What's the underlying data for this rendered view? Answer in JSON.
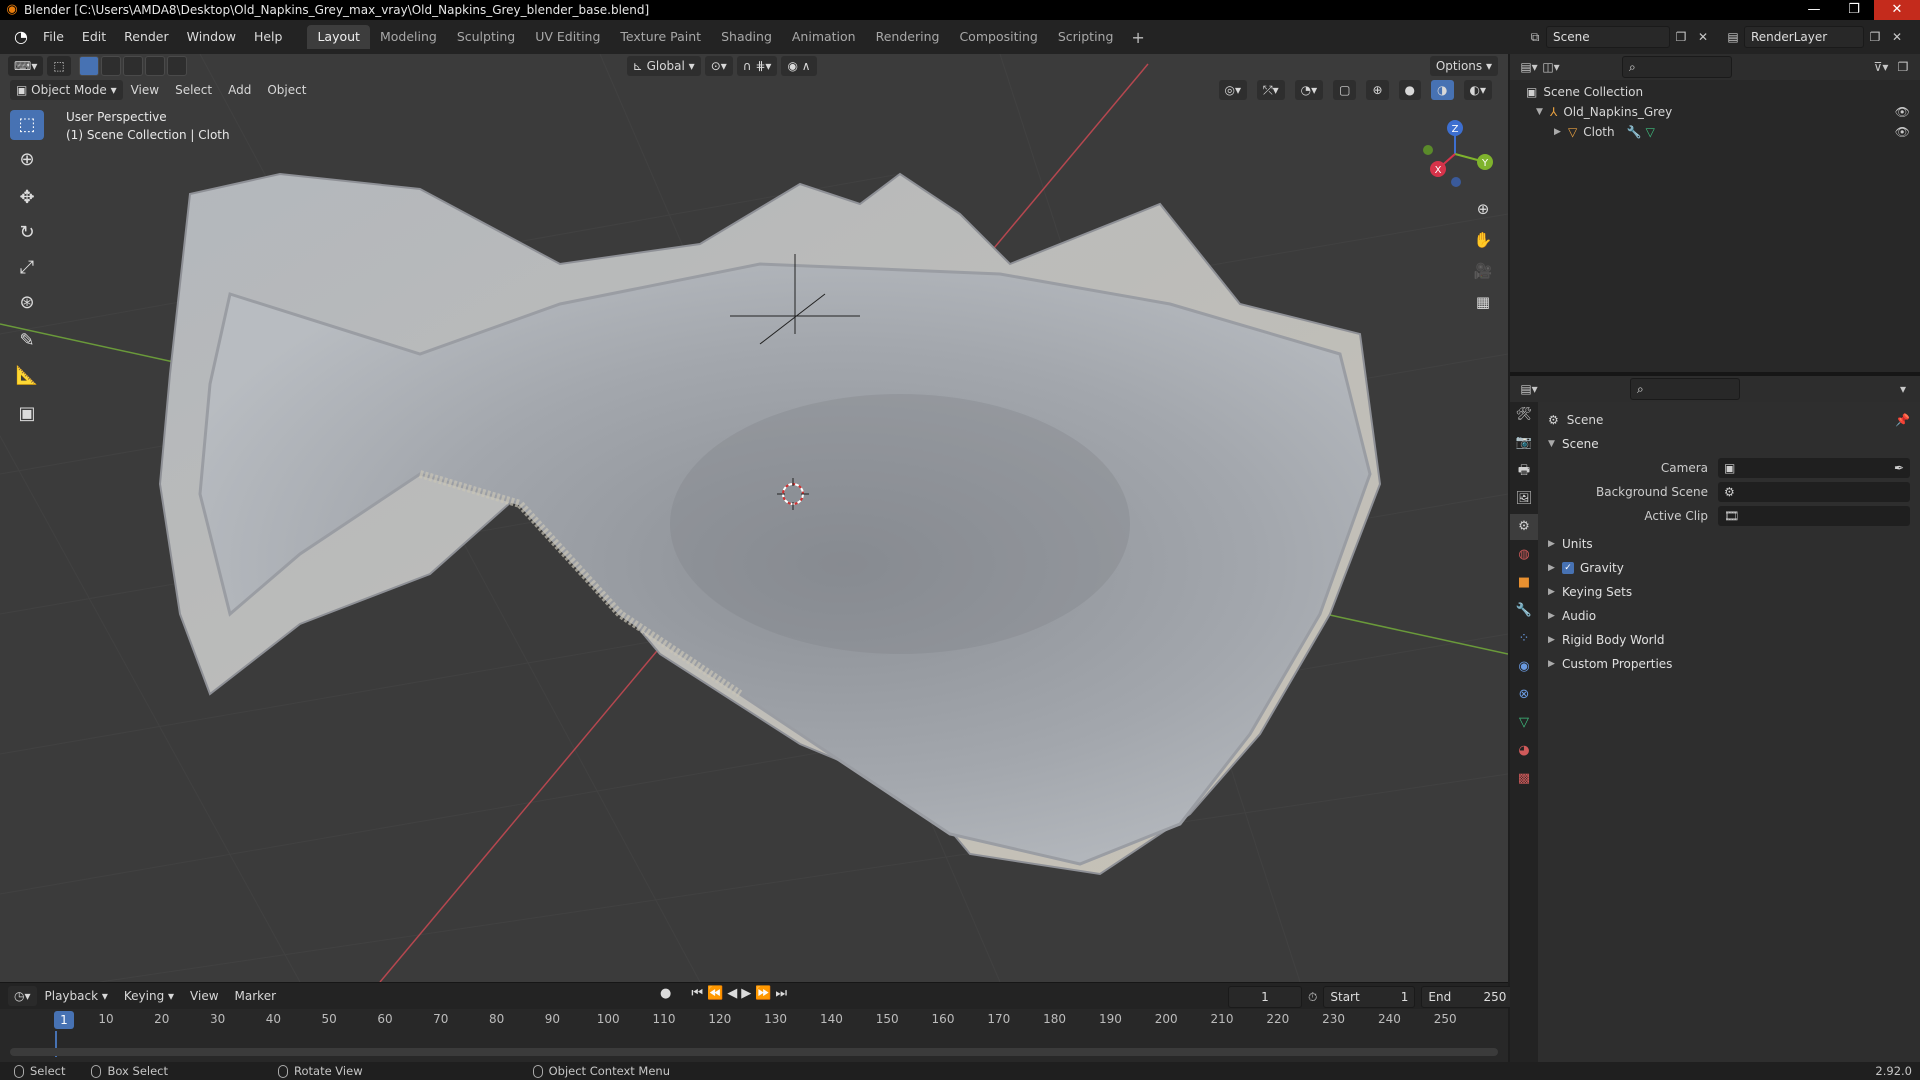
{
  "window": {
    "title": "Blender [C:\\Users\\AMDA8\\Desktop\\Old_Napkins_Grey_max_vray\\Old_Napkins_Grey_blender_base.blend]",
    "controls": [
      "—",
      "❐",
      "✕"
    ]
  },
  "menubar": {
    "menus": [
      "File",
      "Edit",
      "Render",
      "Window",
      "Help"
    ],
    "workspaces": [
      "Layout",
      "Modeling",
      "Sculpting",
      "UV Editing",
      "Texture Paint",
      "Shading",
      "Animation",
      "Rendering",
      "Compositing",
      "Scripting"
    ],
    "active_workspace": "Layout",
    "scene": "Scene",
    "view_layer": "RenderLayer"
  },
  "viewport": {
    "transform_orientation": "Global",
    "options_label": "Options",
    "mode": "Object Mode",
    "menus": [
      "View",
      "Select",
      "Add",
      "Object"
    ],
    "view_name": "User Perspective",
    "collection_info": "(1) Scene Collection | Cloth",
    "gizmo_axes": [
      "X",
      "Y",
      "Z"
    ]
  },
  "timeline": {
    "menus": [
      "Playback",
      "Keying",
      "View",
      "Marker"
    ],
    "current_frame": "1",
    "start_label": "Start",
    "start": "1",
    "end_label": "End",
    "end": "250",
    "ticks": [
      "10",
      "20",
      "30",
      "40",
      "50",
      "60",
      "70",
      "80",
      "90",
      "100",
      "110",
      "120",
      "130",
      "140",
      "150",
      "160",
      "170",
      "180",
      "190",
      "200",
      "210",
      "220",
      "230",
      "240",
      "250"
    ],
    "playhead_label": "1"
  },
  "statusbar": {
    "select": "Select",
    "box_select": "Box Select",
    "rotate_view": "Rotate View",
    "context_menu": "Object Context Menu",
    "version": "2.92.0"
  },
  "outliner": {
    "root": "Scene Collection",
    "items": [
      {
        "label": "Old_Napkins_Grey"
      },
      {
        "label": "Cloth"
      }
    ]
  },
  "properties": {
    "context": "Scene",
    "panel": "Scene",
    "fields": [
      {
        "label": "Camera",
        "value": ""
      },
      {
        "label": "Background Scene",
        "value": ""
      },
      {
        "label": "Active Clip",
        "value": ""
      }
    ],
    "subpanels": [
      "Units",
      "Gravity",
      "Keying Sets",
      "Audio",
      "Rigid Body World",
      "Custom Properties"
    ],
    "gravity_checked": true
  },
  "colors": {
    "accent": "#4772b3",
    "viewport_bg": "#3a3a3a",
    "cloth": "#a9adb3"
  }
}
